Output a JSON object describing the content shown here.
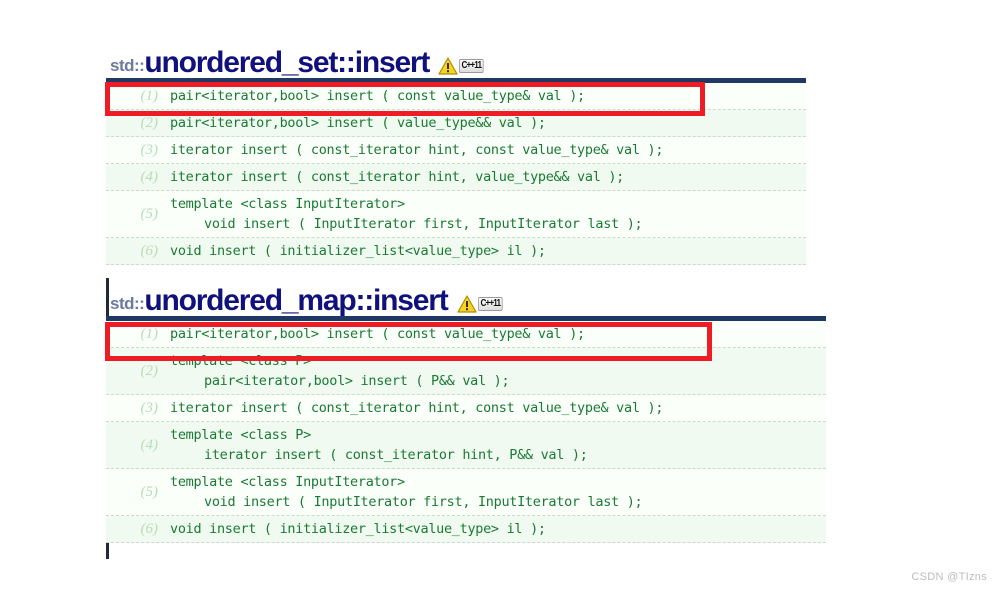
{
  "page": {
    "watermark": "CSDN @TIzns",
    "accent_blue": "#1f3864",
    "title_color": "#10117a",
    "code_color": "#1a7a34",
    "highlight_color": "#ee1c25"
  },
  "sections": [
    {
      "id": "unordered_set_insert",
      "title_prefix": "std::",
      "title_main": "unordered_set::insert",
      "badge": {
        "warning_icon": "warning-triangle-icon",
        "label": "C++11"
      },
      "rows": [
        {
          "num": "(1)",
          "lines": [
            "pair<iterator,bool> insert ( const value_type& val );"
          ]
        },
        {
          "num": "(2)",
          "lines": [
            "pair<iterator,bool> insert ( value_type&& val );"
          ]
        },
        {
          "num": "(3)",
          "lines": [
            "iterator insert ( const_iterator hint, const value_type& val );"
          ]
        },
        {
          "num": "(4)",
          "lines": [
            "iterator insert ( const_iterator hint, value_type&& val );"
          ]
        },
        {
          "num": "(5)",
          "lines": [
            "template <class InputIterator>",
            "void insert ( InputIterator first, InputIterator last );"
          ]
        },
        {
          "num": "(6)",
          "lines": [
            "void insert ( initializer_list<value_type> il );"
          ]
        }
      ]
    },
    {
      "id": "unordered_map_insert",
      "title_prefix": "std::",
      "title_main": "unordered_map::insert",
      "badge": {
        "warning_icon": "warning-triangle-icon",
        "label": "C++11"
      },
      "rows": [
        {
          "num": "(1)",
          "lines": [
            "pair<iterator,bool> insert ( const value_type& val );"
          ]
        },
        {
          "num": "(2)",
          "lines": [
            "template <class P>",
            "pair<iterator,bool> insert ( P&& val );"
          ]
        },
        {
          "num": "(3)",
          "lines": [
            "iterator insert ( const_iterator hint, const value_type& val );"
          ]
        },
        {
          "num": "(4)",
          "lines": [
            "template <class P>",
            "iterator insert ( const_iterator hint, P&& val );"
          ]
        },
        {
          "num": "(5)",
          "lines": [
            "template <class InputIterator>",
            "void insert ( InputIterator first, InputIterator last );"
          ]
        },
        {
          "num": "(6)",
          "lines": [
            "void insert ( initializer_list<value_type> il );"
          ]
        }
      ]
    }
  ],
  "annotations": [
    {
      "name": "highlight-row-set-1",
      "target": "section 1 row (1)"
    },
    {
      "name": "highlight-row-map-1",
      "target": "section 2 row (1)"
    }
  ]
}
